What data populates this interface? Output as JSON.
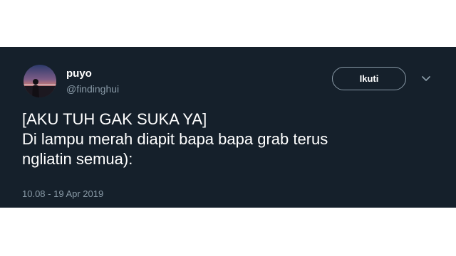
{
  "user": {
    "display_name": "puyo",
    "handle": "@findinghui"
  },
  "actions": {
    "follow_label": "Ikuti",
    "more_icon": "chevron-down-icon"
  },
  "tweet": {
    "lines": [
      "[AKU TUH GAK SUKA YA]",
      "Di lampu merah diapit bapa bapa grab terus",
      "ngliatin semua):"
    ],
    "timestamp": "10.08 - 19 Apr 2019"
  },
  "colors": {
    "card_background": "#15202b",
    "secondary_text": "#8899a6",
    "primary_text": "#ffffff"
  }
}
